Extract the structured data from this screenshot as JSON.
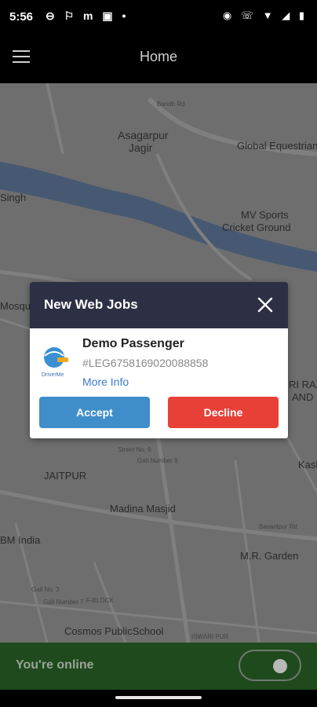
{
  "status_bar": {
    "time": "5:56",
    "left_icons": "⊖ ⚐ m ▣ •",
    "right_icons": "◉ ☏ ▼ ◢ ▮"
  },
  "app_bar": {
    "title": "Home"
  },
  "map": {
    "labels": {
      "asagarpur": "Asagarpur\nJagir",
      "asagarpur_line1": "Asagarpur",
      "asagarpur_line2": "Jagir",
      "global": "Global Equestrian",
      "singh": "Singh",
      "mv_sports_line1": "MV Sports",
      "mv_sports_line2": "Cricket Ground",
      "mosque": "Mosque",
      "jaitpur": "JAITPUR",
      "madina": "Madina Masjid",
      "bm_india": "BM India",
      "mr_garden": "M.R. Garden",
      "fblock": "F-BLOCK",
      "cosmos": "Cosmos PublicSchool",
      "kash": "Kash",
      "ri_raz": "RI RAZ",
      "and": "AND",
      "street6": "Street No. 6",
      "gali9": "Gali Number 9",
      "gali3": "Gali No. 3",
      "gali7": "Gali Number 7",
      "bandh": "Bandh Rd",
      "basantpur": "Basantpur Rd",
      "ishwari": "ISWARI PUR"
    }
  },
  "dialog": {
    "title": "New Web Jobs",
    "passenger_name": "Demo Passenger",
    "job_ref": "#LEG6758169020088858",
    "more_info": "More Info",
    "accept_label": "Accept",
    "decline_label": "Decline",
    "logo_text": "DriverMe"
  },
  "bottom": {
    "online_label": "You're online"
  },
  "colors": {
    "accept": "#3f8ec9",
    "decline": "#e84037",
    "dialog_header": "#2d2f45",
    "bottom_bar": "#1f4a1d"
  }
}
